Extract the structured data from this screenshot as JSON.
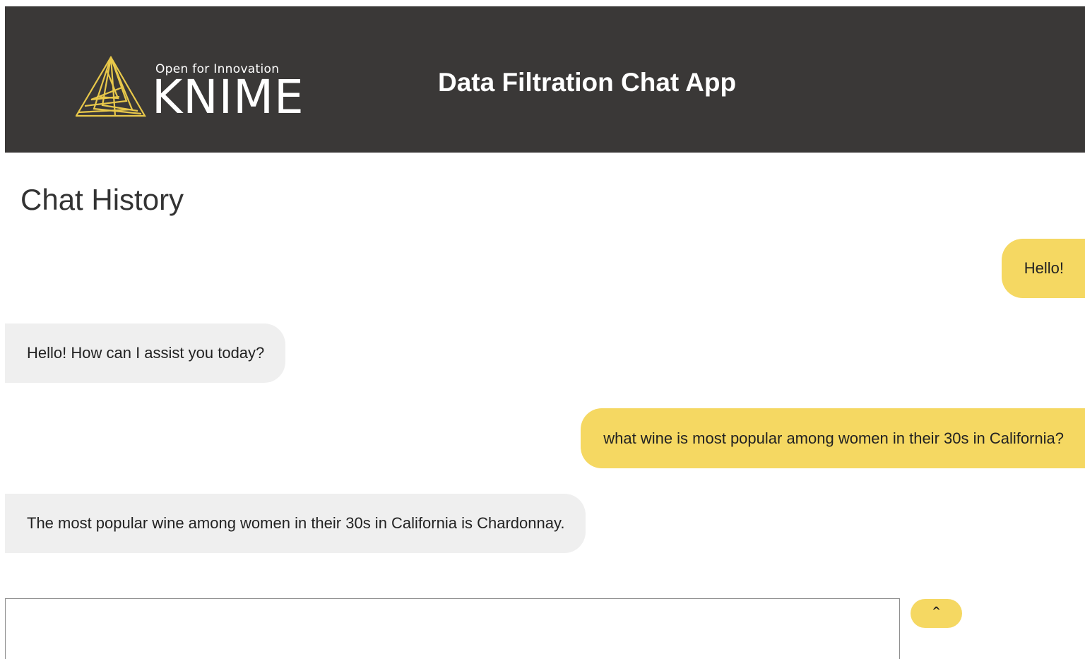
{
  "header": {
    "logo_tagline": "Open for Innovation",
    "logo_wordmark": "KNIME",
    "app_title": "Data Filtration Chat App",
    "background_color": "#3a3837",
    "logo_color": "#e8c84a"
  },
  "chat": {
    "title": "Chat History",
    "messages": [
      {
        "role": "user",
        "text": "Hello!"
      },
      {
        "role": "assistant",
        "text": "Hello! How can I assist you today?"
      },
      {
        "role": "user",
        "text": "what wine is most popular among women in their 30s in California?"
      },
      {
        "role": "assistant",
        "text": "The most popular wine among women in their 30s in California is Chardonnay."
      }
    ]
  },
  "composer": {
    "input_value": "",
    "placeholder": "",
    "send_label": "^"
  },
  "colors": {
    "user_bubble": "#f5d862",
    "assistant_bubble": "#efefef",
    "accent": "#f5d862"
  },
  "icons": {
    "logo": "knime-triangle-icon"
  }
}
